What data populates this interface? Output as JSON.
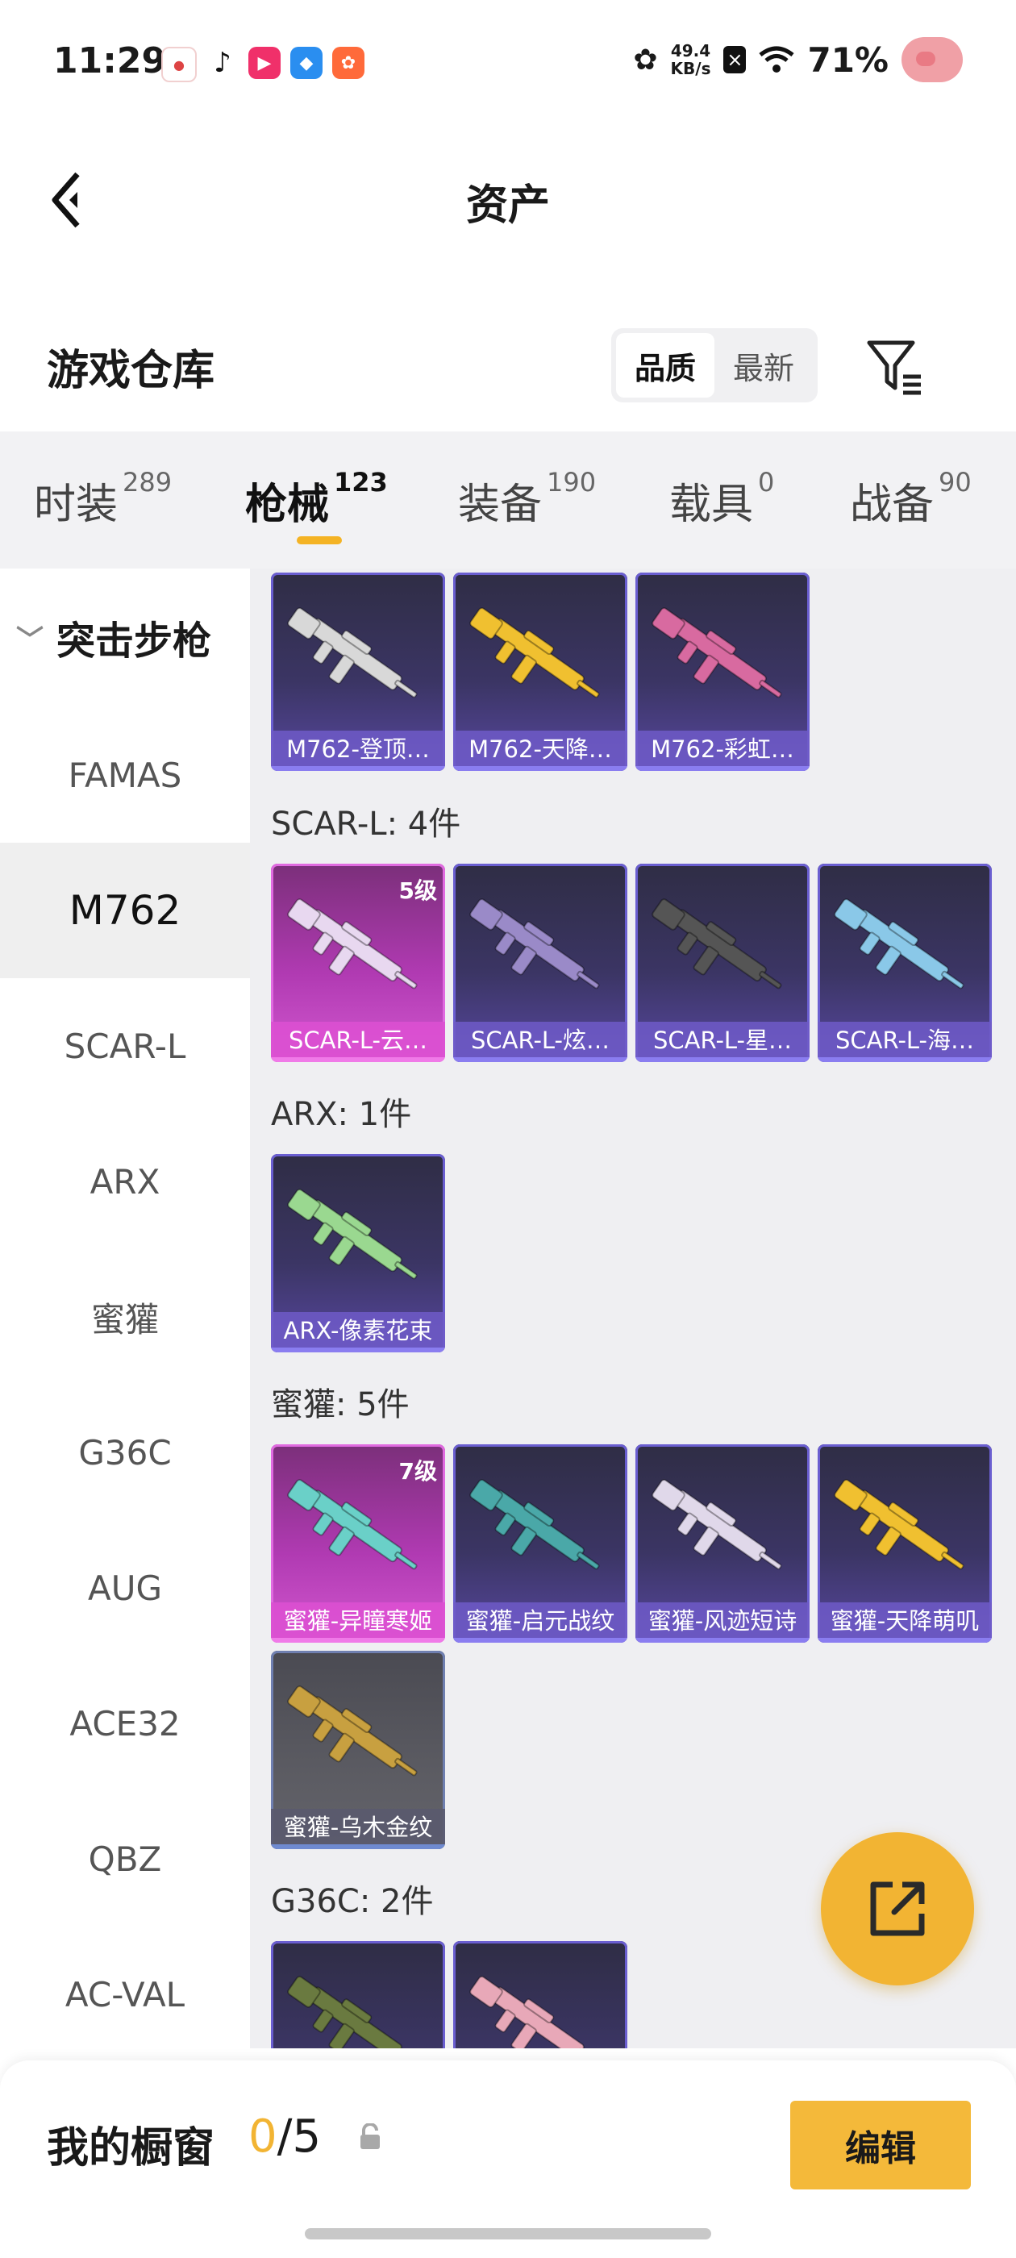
{
  "status_bar": {
    "time": "11:29",
    "speed_value": "49.4",
    "speed_unit": "KB/s",
    "battery": "71%"
  },
  "header": {
    "title": "资产"
  },
  "warehouse": {
    "title": "游戏仓库",
    "sort_options": [
      "品质",
      "最新"
    ],
    "sort_selected": "品质"
  },
  "category_tabs": [
    {
      "label": "时装",
      "count": "289"
    },
    {
      "label": "枪械",
      "count": "123"
    },
    {
      "label": "装备",
      "count": "190"
    },
    {
      "label": "载具",
      "count": "0"
    },
    {
      "label": "战备",
      "count": "90"
    }
  ],
  "sidebar": {
    "group": "突击步枪",
    "items": [
      "FAMAS",
      "M762",
      "SCAR-L",
      "ARX",
      "蜜獾",
      "G36C",
      "AUG",
      "ACE32",
      "QBZ",
      "AC-VAL"
    ],
    "active": "M762"
  },
  "groups": {
    "m762": {
      "items": [
        {
          "name": "M762-登顶…",
          "gun_color": "#d8d8d8"
        },
        {
          "name": "M762-天降…",
          "gun_color": "#f0c030"
        },
        {
          "name": "M762-彩虹…",
          "gun_color": "#d86aa0"
        }
      ]
    },
    "scar": {
      "label": "SCAR-L: 4件",
      "items": [
        {
          "name": "SCAR-L-云…",
          "level": "5级",
          "gun_color": "#e8d8f0"
        },
        {
          "name": "SCAR-L-炫…",
          "gun_color": "#9a8ac8"
        },
        {
          "name": "SCAR-L-星…",
          "gun_color": "#555555"
        },
        {
          "name": "SCAR-L-海…",
          "gun_color": "#8ac8e8"
        }
      ]
    },
    "arx": {
      "label": "ARX: 1件",
      "items": [
        {
          "name": "ARX-像素花束",
          "gun_color": "#9ad890"
        }
      ]
    },
    "honey_badger": {
      "label": "蜜獾: 5件",
      "items": [
        {
          "name": "蜜獾-异瞳寒姬",
          "level": "7级",
          "gun_color": "#6ad0c8"
        },
        {
          "name": "蜜獾-启元战纹",
          "gun_color": "#4aa8a8"
        },
        {
          "name": "蜜獾-风迹短诗",
          "gun_color": "#e0d8ea"
        },
        {
          "name": "蜜獾-天降萌叽",
          "gun_color": "#f0c030"
        },
        {
          "name": "蜜獾-乌木金纹",
          "gun_color": "#c8a040"
        }
      ]
    },
    "g36c": {
      "label": "G36C: 2件",
      "items": [
        {
          "gun_color": "#6a7a40"
        },
        {
          "gun_color": "#e8a8b8"
        }
      ]
    }
  },
  "showcase": {
    "title": "我的橱窗",
    "count_now": "0",
    "count_total": "/5",
    "edit_label": "编辑"
  },
  "colors": {
    "accent": "#f2b433"
  }
}
